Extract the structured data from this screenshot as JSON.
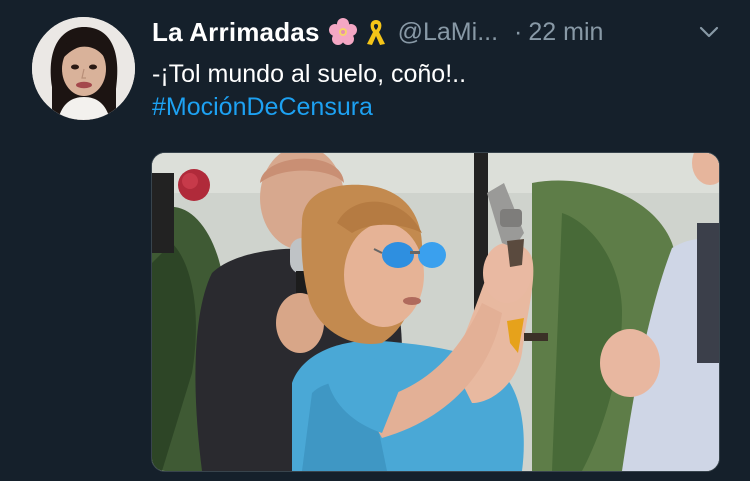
{
  "tweet": {
    "display_name": "La Arrimadas",
    "name_emoji_1": "cherry-blossom",
    "name_emoji_2": "yellow-ribbon",
    "handle": "@LaMi...",
    "separator": "·",
    "time": "22 min",
    "text_line": "-¡Tol mundo al suelo, coño!..",
    "hashtag": "#MociónDeCensura",
    "media_icon": "photo-woman-sunglasses-holding-revolver"
  },
  "colors": {
    "background": "#15202b",
    "name": "#ffffff",
    "secondary": "#8899a6",
    "link": "#1da1f2",
    "shirt": "#4aa8d6"
  }
}
